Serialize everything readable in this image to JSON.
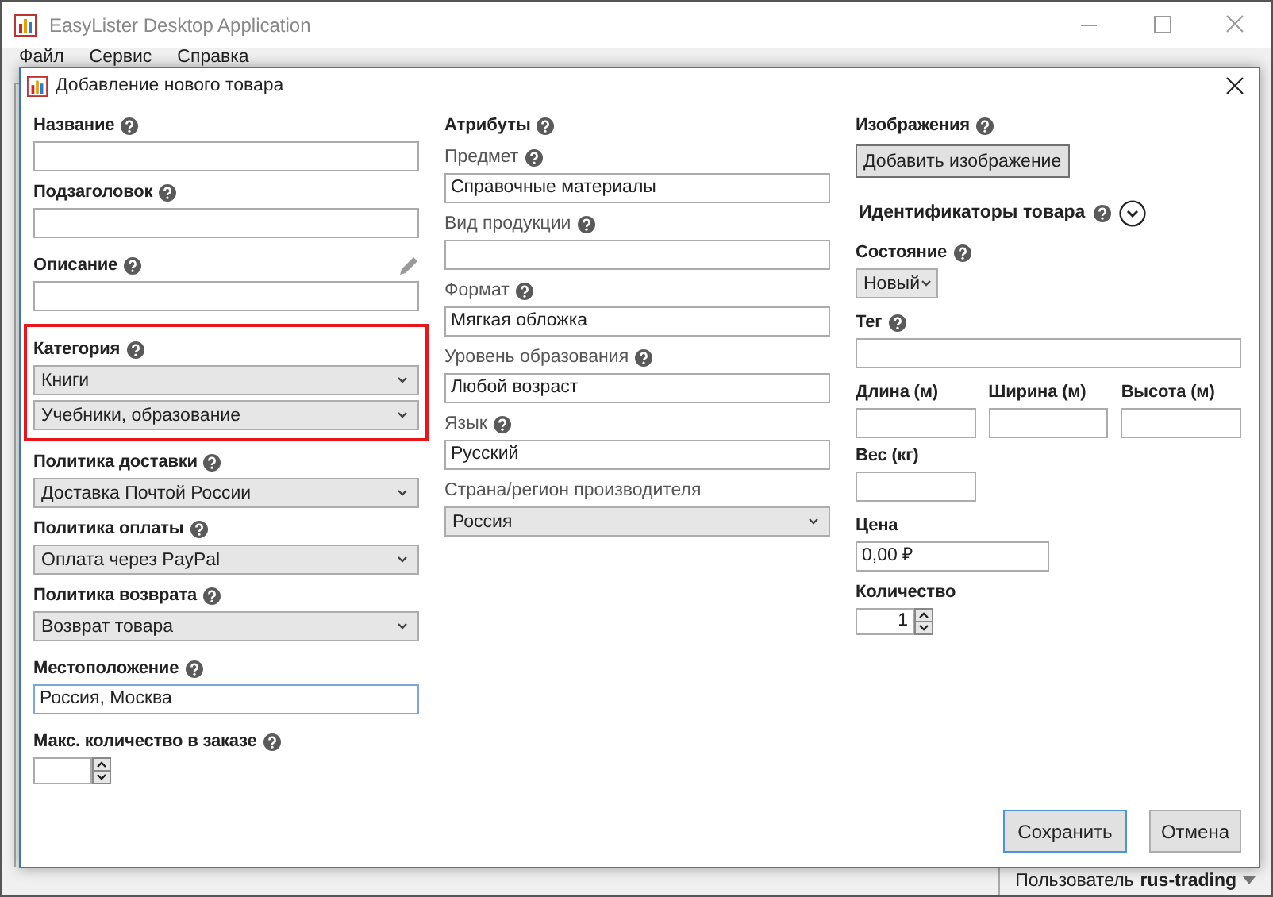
{
  "app": {
    "title": "EasyLister Desktop Application",
    "menu": [
      "Файл",
      "Сервис",
      "Справка"
    ]
  },
  "dialog": {
    "title": "Добавление нового товара",
    "columns": [
      {
        "items": [
          {
            "kind": "text",
            "label": "Название",
            "help": true
          },
          {
            "kind": "text",
            "label": "Подзаголовок",
            "help": true
          },
          {
            "kind": "text",
            "label": "Описание",
            "help": true,
            "edit_icon": true
          },
          {
            "kind": "group",
            "highlighted": true,
            "label": "Категория",
            "help": true,
            "items": [
              {
                "kind": "select",
                "value": "Книги"
              },
              {
                "kind": "select",
                "value": "Учебники, образование"
              }
            ]
          },
          {
            "kind": "select",
            "label": "Политика доставки",
            "help": true,
            "value": "Доставка Почтой России"
          },
          {
            "kind": "select",
            "label": "Политика оплаты",
            "help": true,
            "value": "Оплата через PayPal"
          },
          {
            "kind": "select",
            "label": "Политика возврата",
            "help": true,
            "value": "Возврат товара"
          },
          {
            "kind": "text",
            "label": "Местоположение",
            "help": true,
            "value": "Россия, Москва",
            "focused": true
          },
          {
            "kind": "spinner",
            "label": "Макс. количество в заказе",
            "help": true
          }
        ]
      },
      {
        "items": [
          {
            "kind": "header",
            "label": "Атрибуты",
            "help": true
          },
          {
            "kind": "text",
            "label": "Предмет",
            "help": true,
            "value": "Справочные материалы"
          },
          {
            "kind": "text",
            "label": "Вид продукции",
            "help": true
          },
          {
            "kind": "text",
            "label": "Формат",
            "help": true,
            "value": "Мягкая обложка"
          },
          {
            "kind": "text",
            "label": "Уровень образования",
            "help": true,
            "value": "Любой возраст"
          },
          {
            "kind": "text",
            "label": "Язык",
            "help": true,
            "value": "Русский"
          },
          {
            "kind": "select",
            "label": "Страна/регион производителя",
            "help": false,
            "value": "Россия"
          }
        ]
      },
      {
        "items": [
          {
            "kind": "button",
            "label": "Изображения",
            "help": true,
            "button": "Добавить изображение"
          },
          {
            "kind": "expander",
            "label": "Идентификаторы товара",
            "help": true,
            "expanded": false
          },
          {
            "kind": "select",
            "label": "Состояние",
            "help": true,
            "value": "Новый",
            "compact": true
          },
          {
            "kind": "text",
            "label": "Тег",
            "help": true
          },
          {
            "kind": "row",
            "items": [
              {
                "kind": "text",
                "label": "Длина (м)",
                "help": false
              },
              {
                "kind": "text",
                "label": "Ширина (м)",
                "help": false
              },
              {
                "kind": "text",
                "label": "Высота (м)",
                "help": false
              }
            ]
          },
          {
            "kind": "row",
            "items": [
              {
                "kind": "text",
                "label": "Вес (кг)",
                "help": false
              }
            ]
          },
          {
            "kind": "price",
            "label": "Цена",
            "help": false,
            "value": "0,00 ₽"
          },
          {
            "kind": "spinner",
            "label": "Количество",
            "help": false,
            "value": "1"
          }
        ]
      }
    ],
    "buttons": [
      {
        "label": "Сохранить",
        "default": true
      },
      {
        "label": "Отмена",
        "default": false
      }
    ]
  },
  "status_bar": {
    "label": "Пользователь",
    "user": "rus-trading"
  }
}
